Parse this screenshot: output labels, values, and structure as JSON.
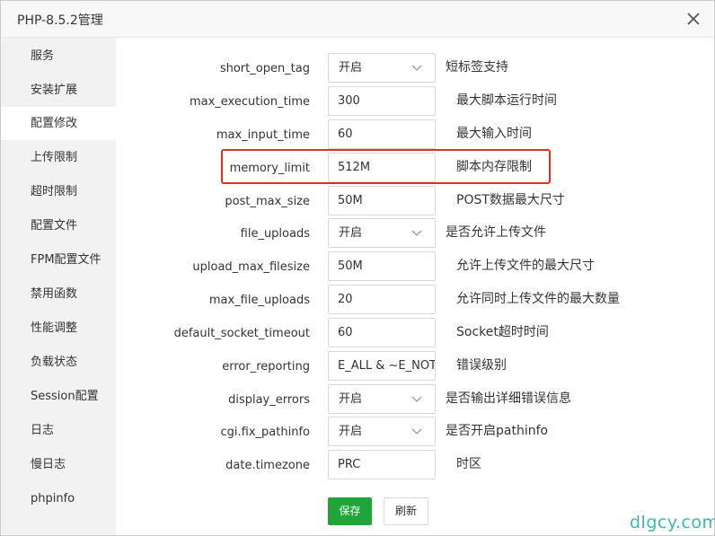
{
  "window": {
    "title": "PHP-8.5.2管理"
  },
  "sidebar": {
    "items": [
      {
        "label": "服务"
      },
      {
        "label": "安装扩展"
      },
      {
        "label": "配置修改"
      },
      {
        "label": "上传限制"
      },
      {
        "label": "超时限制"
      },
      {
        "label": "配置文件"
      },
      {
        "label": "FPM配置文件"
      },
      {
        "label": "禁用函数"
      },
      {
        "label": "性能调整"
      },
      {
        "label": "负载状态"
      },
      {
        "label": "Session配置"
      },
      {
        "label": "日志"
      },
      {
        "label": "慢日志"
      },
      {
        "label": "phpinfo"
      }
    ],
    "active_item": "配置修改"
  },
  "settings": [
    {
      "name": "short_open_tag",
      "type": "select",
      "value": "开启",
      "description": "短标签支持"
    },
    {
      "name": "max_execution_time",
      "type": "input",
      "value": "300",
      "description": "最大脚本运行时间"
    },
    {
      "name": "max_input_time",
      "type": "input",
      "value": "60",
      "description": "最大输入时间"
    },
    {
      "name": "memory_limit",
      "type": "input",
      "value": "512M",
      "description": "脚本内存限制"
    },
    {
      "name": "post_max_size",
      "type": "input",
      "value": "50M",
      "description": "POST数据最大尺寸"
    },
    {
      "name": "file_uploads",
      "type": "select",
      "value": "开启",
      "description": "是否允许上传文件"
    },
    {
      "name": "upload_max_filesize",
      "type": "input",
      "value": "50M",
      "description": "允许上传文件的最大尺寸"
    },
    {
      "name": "max_file_uploads",
      "type": "input",
      "value": "20",
      "description": "允许同时上传文件的最大数量"
    },
    {
      "name": "default_socket_timeout",
      "type": "input",
      "value": "60",
      "description": "Socket超时时间"
    },
    {
      "name": "error_reporting",
      "type": "input",
      "value": "E_ALL & ~E_NOT",
      "description": "错误级别"
    },
    {
      "name": "display_errors",
      "type": "select",
      "value": "开启",
      "description": "是否输出详细错误信息"
    },
    {
      "name": "cgi.fix_pathinfo",
      "type": "select",
      "value": "开启",
      "description": "是否开启pathinfo"
    },
    {
      "name": "date.timezone",
      "type": "input",
      "value": "PRC",
      "description": "时区"
    }
  ],
  "highlighted_setting": "memory_limit",
  "buttons": {
    "save": "保存",
    "refresh": "刷新"
  },
  "watermark": "dlgcy.com",
  "colors": {
    "primary": "#20a53a",
    "highlight_border": "#e0301e",
    "sidebar_bg": "#f2f2f2",
    "watermark": "#3fb5b0"
  }
}
